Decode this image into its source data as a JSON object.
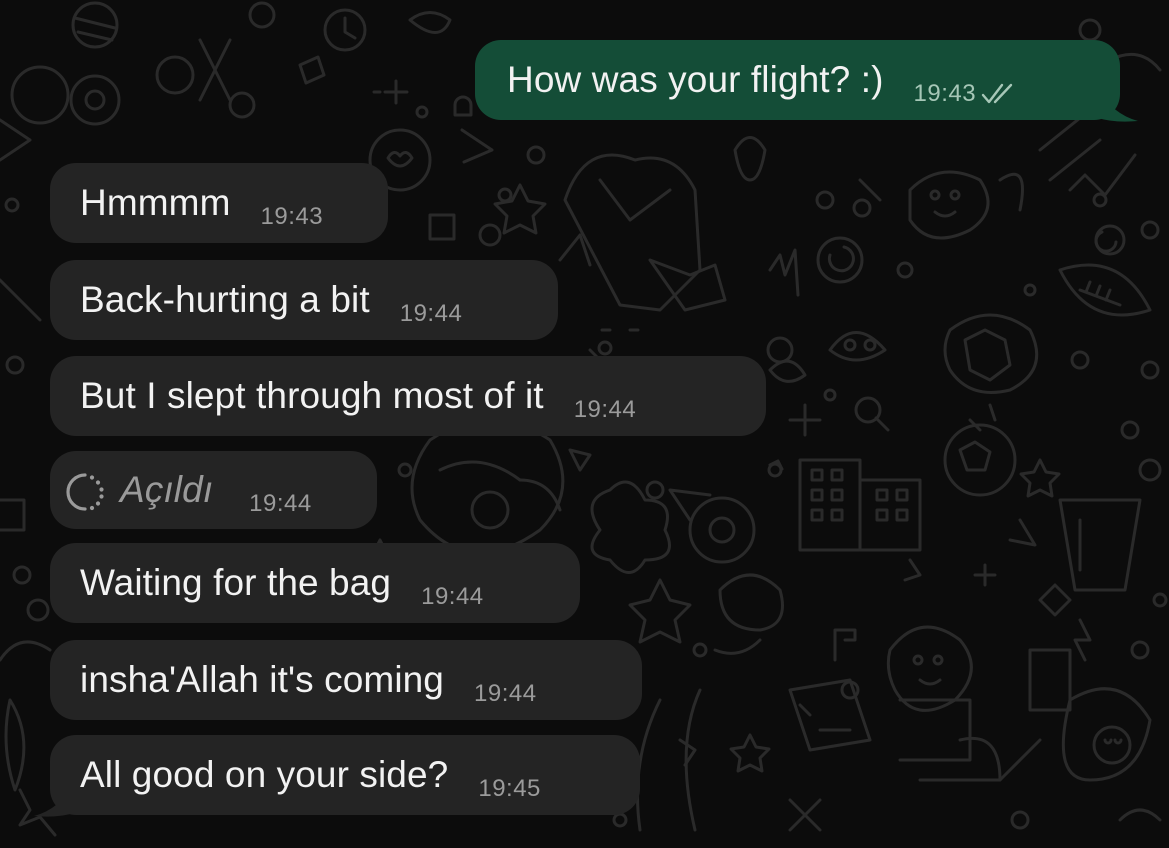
{
  "colors": {
    "background": "#0c0c0c",
    "incoming_bubble": "#242424",
    "outgoing_bubble": "#144d37",
    "message_text": "#f2f2f2",
    "timestamp": "#9b9b9b",
    "deleted_text": "#9a9a9a"
  },
  "messages": [
    {
      "direction": "out",
      "text": "How was your flight? :)",
      "time": "19:43",
      "status": "read-double-check-icon"
    },
    {
      "direction": "in",
      "text": "Hmmmm",
      "time": "19:43"
    },
    {
      "direction": "in",
      "text": "Back-hurting a bit",
      "time": "19:44"
    },
    {
      "direction": "in",
      "text": "But I slept through most of it",
      "time": "19:44"
    },
    {
      "direction": "in",
      "text": "Açıldı",
      "time": "19:44",
      "icon": "view-once-opened-icon"
    },
    {
      "direction": "in",
      "text": "Waiting for the bag",
      "time": "19:44"
    },
    {
      "direction": "in",
      "text": "insha'Allah it's coming",
      "time": "19:44"
    },
    {
      "direction": "in",
      "text": "All good on your side?",
      "time": "19:45"
    }
  ]
}
